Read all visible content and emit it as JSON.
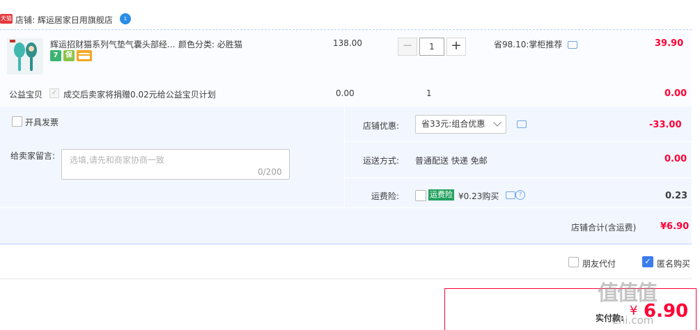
{
  "shop": {
    "badge": "天猫",
    "label": "店铺: 辉运居家日用旗舰店",
    "chat_badge": "1"
  },
  "item": {
    "title": "辉运招财猫系列气垫气囊头部经...",
    "sku": "颜色分类: 必胜猫",
    "service_icons": [
      "7",
      "保",
      "card"
    ],
    "unit_price": "138.00",
    "quantity": "1",
    "minus": "−",
    "plus": "+",
    "saving": "省98.10:掌柜推荐",
    "total": "39.90"
  },
  "charity": {
    "label": "公益宝贝",
    "description": "成交后卖家将捐赠0.02元给公益宝贝计划",
    "price": "0.00",
    "quantity": "1",
    "total": "0.00"
  },
  "options": {
    "invoice_label": "开具发票",
    "memo_label": "给卖家留言:",
    "memo_placeholder": "选填,请先和商家协商一致",
    "memo_count": "0/200",
    "promo_label": "店铺优惠:",
    "promo_value": "省33元:组合优惠",
    "promo_amount": "-33.00",
    "shipping_label": "运送方式:",
    "shipping_value": "普通配送 快递 免邮",
    "shipping_amount": "0.00",
    "insurance_label": "运费险:",
    "insurance_badge": "运费险",
    "insurance_price": "¥0.23购买",
    "insurance_amount": "0.23",
    "shop_total_label": "店铺合计(含运费)",
    "shop_total_amount": "¥6.90"
  },
  "bottom": {
    "friend_pay_label": "朋友代付",
    "anonymous_label": "匿名购买",
    "pay_label": "实付款:",
    "pay_currency": "¥",
    "pay_amount": "6.90"
  },
  "watermark": {
    "logo": "值值值",
    "url": "zhi.com"
  },
  "colors": {
    "price_red": "#ff0036",
    "panel_bg": "#f2f7ff",
    "divider_blue": "#b2d1ff",
    "checkbox_blue": "#3b7ded",
    "insurance_green": "#23a15e"
  }
}
